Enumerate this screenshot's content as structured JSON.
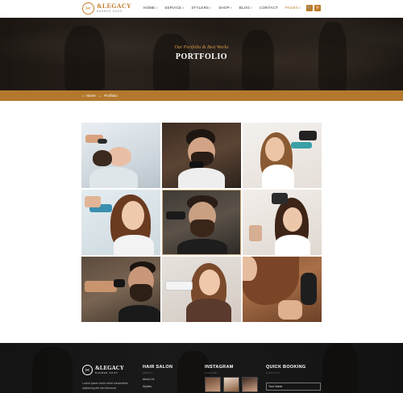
{
  "header": {
    "logo": {
      "name": "&LEGACY",
      "subtitle": "BARBER SHOP",
      "icon": "scissors-logo-icon"
    },
    "nav": [
      {
        "label": "HOME",
        "has_caret": true
      },
      {
        "label": "SERVICE",
        "has_caret": true
      },
      {
        "label": "STYLERS",
        "has_caret": true
      },
      {
        "label": "SHOP",
        "has_caret": true
      },
      {
        "label": "BLOG",
        "has_caret": true
      },
      {
        "label": "CONTACT",
        "has_caret": false
      },
      {
        "label": "PAGES",
        "has_caret": true,
        "active": true
      }
    ],
    "cart_icon": "cart-icon",
    "search_icon": "search-icon"
  },
  "hero": {
    "subtitle": "Our Portfolio & Best Works",
    "title": "PORTFOLIO"
  },
  "breadcrumb": {
    "home": "Home",
    "separator": "→",
    "current": "Portfolio"
  },
  "gallery": {
    "tiles": [
      {
        "name": "portfolio-hair-wash",
        "scene": "hair-wash"
      },
      {
        "name": "portfolio-beard-trim",
        "scene": "beard-trim"
      },
      {
        "name": "portfolio-hair-dryer",
        "scene": "hair-dryer"
      },
      {
        "name": "portfolio-hair-brushing",
        "scene": "hair-brushing"
      },
      {
        "name": "portfolio-beard-man",
        "scene": "beard-man"
      },
      {
        "name": "portfolio-hair-drying-curls",
        "scene": "hair-drying-curls"
      },
      {
        "name": "portfolio-clipper-cut",
        "scene": "clipper-cut"
      },
      {
        "name": "portfolio-blow-dry",
        "scene": "blow-dry"
      },
      {
        "name": "portfolio-hair-brush-closeup",
        "scene": "hair-brush-closeup"
      }
    ]
  },
  "footer": {
    "logo": {
      "name": "&LEGACY",
      "subtitle": "BARBER SHOP"
    },
    "description": "Lorem ipsum dolor amet consectetur adipiscing elit sed eiusmod",
    "columns": [
      {
        "title": "HAIR SALON",
        "sub": "ABOUT",
        "links": [
          "About Us",
          "Stylists"
        ]
      },
      {
        "title": "INSTAGRAM",
        "sub": "GALLERY"
      },
      {
        "title": "QUICK BOOKING",
        "sub": "CONTACT",
        "field_label": "Your Name"
      }
    ]
  },
  "colors": {
    "accent": "#c07a26",
    "breadcrumb_bar": "#b3782d",
    "footer_bg": "#222222"
  }
}
